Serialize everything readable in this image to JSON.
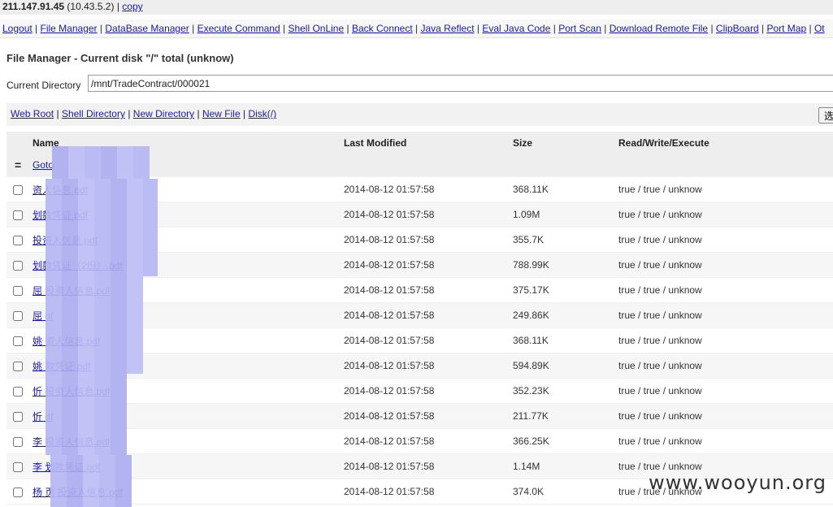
{
  "host": {
    "ip": "211.147.91.45",
    "internal_ip": "(10.43.5.2)",
    "separator": "|",
    "copy_label": "copy"
  },
  "nav": {
    "items": [
      {
        "label": "Logout"
      },
      {
        "label": "File Manager"
      },
      {
        "label": "DataBase Manager"
      },
      {
        "label": "Execute Command"
      },
      {
        "label": "Shell OnLine"
      },
      {
        "label": "Back Connect"
      },
      {
        "label": "Java Reflect"
      },
      {
        "label": "Eval Java Code"
      },
      {
        "label": "Port Scan"
      },
      {
        "label": "Download Remote File"
      },
      {
        "label": "ClipBoard"
      },
      {
        "label": "Port Map"
      },
      {
        "label": "Ot"
      }
    ],
    "separator": "|"
  },
  "file_manager": {
    "title": "File Manager - Current disk \"/\" total (unknow)",
    "current_dir_label": "Current Directory",
    "current_dir_value": "/mnt/TradeContract/000021"
  },
  "toolbar": {
    "links": [
      {
        "label": "Web Root"
      },
      {
        "label": "Shell Directory"
      },
      {
        "label": "New Directory"
      },
      {
        "label": "New File"
      },
      {
        "label": "Disk(/)"
      }
    ],
    "separator": "|",
    "select_button_label": "选"
  },
  "table": {
    "headers": {
      "name": "Name",
      "modified": "Last Modified",
      "size": "Size",
      "rwx": "Read/Write/Execute"
    },
    "goto": {
      "mark": "=",
      "label": "Goto"
    },
    "rows": [
      {
        "name": "资人信息.pdf",
        "modified": "2014-08-12 01:57:58",
        "size": "368.11K",
        "rwx": "true / true / unknow"
      },
      {
        "name": "划款凭证.pdf",
        "modified": "2014-08-12 01:57:58",
        "size": "1.09M",
        "rwx": "true / true / unknow"
      },
      {
        "name": "投资人信息.pdf",
        "modified": "2014-08-12 01:57:58",
        "size": "355.7K",
        "rwx": "true / true / unknow"
      },
      {
        "name": "划款凭证（2份）.pdf",
        "modified": "2014-08-12 01:57:58",
        "size": "788.99K",
        "rwx": "true / true / unknow"
      },
      {
        "name": "屈 投资人信息.pdf",
        "modified": "2014-08-12 01:57:58",
        "size": "375.17K",
        "rwx": "true / true / unknow"
      },
      {
        "name": "屈 df",
        "modified": "2014-08-12 01:57:58",
        "size": "249.86K",
        "rwx": "true / true / unknow"
      },
      {
        "name": "姚 资人信息.pdf",
        "modified": "2014-08-12 01:57:58",
        "size": "368.11K",
        "rwx": "true / true / unknow"
      },
      {
        "name": "姚 款凭证.pdf",
        "modified": "2014-08-12 01:57:58",
        "size": "594.89K",
        "rwx": "true / true / unknow"
      },
      {
        "name": "忻 投资人信息.pdf",
        "modified": "2014-08-12 01:57:58",
        "size": "352.23K",
        "rwx": "true / true / unknow"
      },
      {
        "name": "忻 df",
        "modified": "2014-08-12 01:57:58",
        "size": "211.77K",
        "rwx": "true / true / unknow"
      },
      {
        "name": "李 投资人信息.pdf",
        "modified": "2014-08-12 01:57:58",
        "size": "366.25K",
        "rwx": "true / true / unknow"
      },
      {
        "name": "李 划款凭证.pdf",
        "modified": "2014-08-12 01:57:58",
        "size": "1.14M",
        "rwx": "true / true / unknow"
      },
      {
        "name": "杨 页 投资人信息.pdf",
        "modified": "2014-08-12 01:57:58",
        "size": "374.0K",
        "rwx": "true / true / unknow"
      }
    ]
  },
  "watermark": "www.wooyun.org",
  "colors": {
    "link": "#1a1aaa",
    "mosaic": "#b9b9f2"
  }
}
